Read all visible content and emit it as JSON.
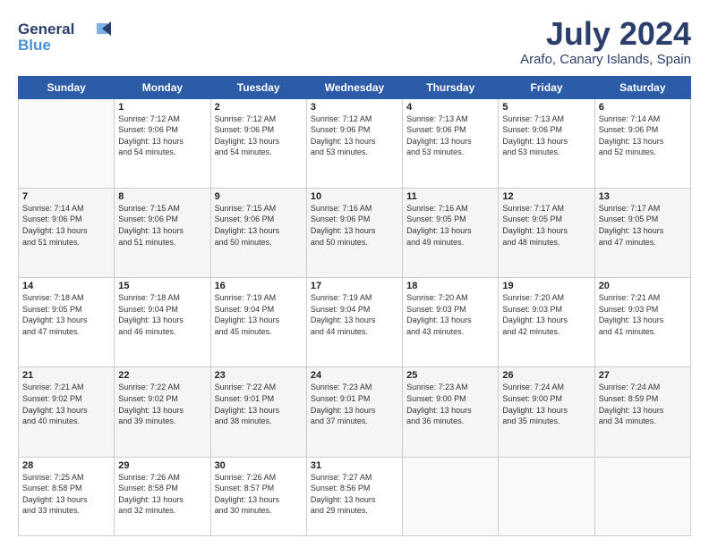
{
  "logo": {
    "line1": "General",
    "line2": "Blue"
  },
  "title": {
    "month_year": "July 2024",
    "location": "Arafo, Canary Islands, Spain"
  },
  "headers": [
    "Sunday",
    "Monday",
    "Tuesday",
    "Wednesday",
    "Thursday",
    "Friday",
    "Saturday"
  ],
  "weeks": [
    [
      {
        "day": "",
        "info": ""
      },
      {
        "day": "1",
        "info": "Sunrise: 7:12 AM\nSunset: 9:06 PM\nDaylight: 13 hours\nand 54 minutes."
      },
      {
        "day": "2",
        "info": "Sunrise: 7:12 AM\nSunset: 9:06 PM\nDaylight: 13 hours\nand 54 minutes."
      },
      {
        "day": "3",
        "info": "Sunrise: 7:12 AM\nSunset: 9:06 PM\nDaylight: 13 hours\nand 53 minutes."
      },
      {
        "day": "4",
        "info": "Sunrise: 7:13 AM\nSunset: 9:06 PM\nDaylight: 13 hours\nand 53 minutes."
      },
      {
        "day": "5",
        "info": "Sunrise: 7:13 AM\nSunset: 9:06 PM\nDaylight: 13 hours\nand 53 minutes."
      },
      {
        "day": "6",
        "info": "Sunrise: 7:14 AM\nSunset: 9:06 PM\nDaylight: 13 hours\nand 52 minutes."
      }
    ],
    [
      {
        "day": "7",
        "info": "Sunrise: 7:14 AM\nSunset: 9:06 PM\nDaylight: 13 hours\nand 51 minutes."
      },
      {
        "day": "8",
        "info": "Sunrise: 7:15 AM\nSunset: 9:06 PM\nDaylight: 13 hours\nand 51 minutes."
      },
      {
        "day": "9",
        "info": "Sunrise: 7:15 AM\nSunset: 9:06 PM\nDaylight: 13 hours\nand 50 minutes."
      },
      {
        "day": "10",
        "info": "Sunrise: 7:16 AM\nSunset: 9:06 PM\nDaylight: 13 hours\nand 50 minutes."
      },
      {
        "day": "11",
        "info": "Sunrise: 7:16 AM\nSunset: 9:05 PM\nDaylight: 13 hours\nand 49 minutes."
      },
      {
        "day": "12",
        "info": "Sunrise: 7:17 AM\nSunset: 9:05 PM\nDaylight: 13 hours\nand 48 minutes."
      },
      {
        "day": "13",
        "info": "Sunrise: 7:17 AM\nSunset: 9:05 PM\nDaylight: 13 hours\nand 47 minutes."
      }
    ],
    [
      {
        "day": "14",
        "info": "Sunrise: 7:18 AM\nSunset: 9:05 PM\nDaylight: 13 hours\nand 47 minutes."
      },
      {
        "day": "15",
        "info": "Sunrise: 7:18 AM\nSunset: 9:04 PM\nDaylight: 13 hours\nand 46 minutes."
      },
      {
        "day": "16",
        "info": "Sunrise: 7:19 AM\nSunset: 9:04 PM\nDaylight: 13 hours\nand 45 minutes."
      },
      {
        "day": "17",
        "info": "Sunrise: 7:19 AM\nSunset: 9:04 PM\nDaylight: 13 hours\nand 44 minutes."
      },
      {
        "day": "18",
        "info": "Sunrise: 7:20 AM\nSunset: 9:03 PM\nDaylight: 13 hours\nand 43 minutes."
      },
      {
        "day": "19",
        "info": "Sunrise: 7:20 AM\nSunset: 9:03 PM\nDaylight: 13 hours\nand 42 minutes."
      },
      {
        "day": "20",
        "info": "Sunrise: 7:21 AM\nSunset: 9:03 PM\nDaylight: 13 hours\nand 41 minutes."
      }
    ],
    [
      {
        "day": "21",
        "info": "Sunrise: 7:21 AM\nSunset: 9:02 PM\nDaylight: 13 hours\nand 40 minutes."
      },
      {
        "day": "22",
        "info": "Sunrise: 7:22 AM\nSunset: 9:02 PM\nDaylight: 13 hours\nand 39 minutes."
      },
      {
        "day": "23",
        "info": "Sunrise: 7:22 AM\nSunset: 9:01 PM\nDaylight: 13 hours\nand 38 minutes."
      },
      {
        "day": "24",
        "info": "Sunrise: 7:23 AM\nSunset: 9:01 PM\nDaylight: 13 hours\nand 37 minutes."
      },
      {
        "day": "25",
        "info": "Sunrise: 7:23 AM\nSunset: 9:00 PM\nDaylight: 13 hours\nand 36 minutes."
      },
      {
        "day": "26",
        "info": "Sunrise: 7:24 AM\nSunset: 9:00 PM\nDaylight: 13 hours\nand 35 minutes."
      },
      {
        "day": "27",
        "info": "Sunrise: 7:24 AM\nSunset: 8:59 PM\nDaylight: 13 hours\nand 34 minutes."
      }
    ],
    [
      {
        "day": "28",
        "info": "Sunrise: 7:25 AM\nSunset: 8:58 PM\nDaylight: 13 hours\nand 33 minutes."
      },
      {
        "day": "29",
        "info": "Sunrise: 7:26 AM\nSunset: 8:58 PM\nDaylight: 13 hours\nand 32 minutes."
      },
      {
        "day": "30",
        "info": "Sunrise: 7:26 AM\nSunset: 8:57 PM\nDaylight: 13 hours\nand 30 minutes."
      },
      {
        "day": "31",
        "info": "Sunrise: 7:27 AM\nSunset: 8:56 PM\nDaylight: 13 hours\nand 29 minutes."
      },
      {
        "day": "",
        "info": ""
      },
      {
        "day": "",
        "info": ""
      },
      {
        "day": "",
        "info": ""
      }
    ]
  ]
}
